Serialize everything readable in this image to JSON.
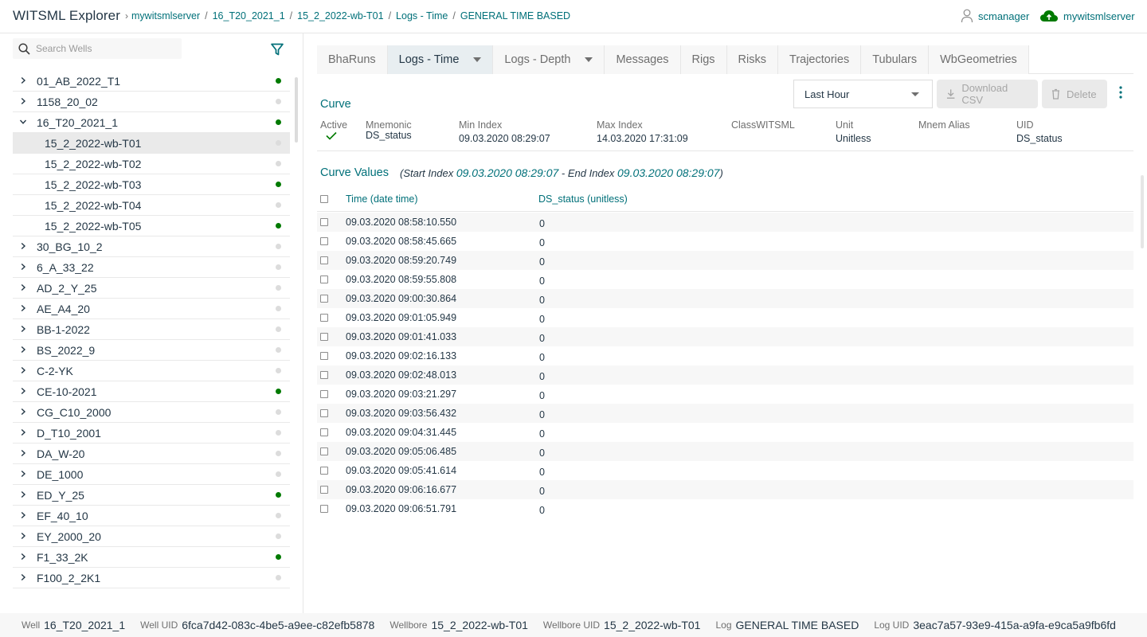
{
  "app_title": "WITSML Explorer",
  "breadcrumb": [
    "mywitsmlserver",
    "16_T20_2021_1",
    "15_2_2022-wb-T01",
    "Logs - Time",
    "GENERAL TIME BASED"
  ],
  "user": "scmanager",
  "server": "mywitsmlserver",
  "search": {
    "placeholder": "Search Wells"
  },
  "tree": [
    {
      "label": "01_AB_2022_T1",
      "expanded": false,
      "child": false,
      "active": true
    },
    {
      "label": "1158_20_02",
      "expanded": false,
      "child": false,
      "active": false
    },
    {
      "label": "16_T20_2021_1",
      "expanded": true,
      "child": false,
      "active": true
    },
    {
      "label": "15_2_2022-wb-T01",
      "child": true,
      "active": false,
      "selected": true
    },
    {
      "label": "15_2_2022-wb-T02",
      "child": true,
      "active": false
    },
    {
      "label": "15_2_2022-wb-T03",
      "child": true,
      "active": true
    },
    {
      "label": "15_2_2022-wb-T04",
      "child": true,
      "active": false
    },
    {
      "label": "15_2_2022-wb-T05",
      "child": true,
      "active": true
    },
    {
      "label": "30_BG_10_2",
      "expanded": false,
      "child": false,
      "active": false
    },
    {
      "label": "6_A_33_22",
      "expanded": false,
      "child": false,
      "active": false
    },
    {
      "label": "AD_2_Y_25",
      "expanded": false,
      "child": false,
      "active": false
    },
    {
      "label": "AE_A4_20",
      "expanded": false,
      "child": false,
      "active": false
    },
    {
      "label": "BB-1-2022",
      "expanded": false,
      "child": false,
      "active": false
    },
    {
      "label": "BS_2022_9",
      "expanded": false,
      "child": false,
      "active": false
    },
    {
      "label": "C-2-YK",
      "expanded": false,
      "child": false,
      "active": false
    },
    {
      "label": "CE-10-2021",
      "expanded": false,
      "child": false,
      "active": true
    },
    {
      "label": "CG_C10_2000",
      "expanded": false,
      "child": false,
      "active": false
    },
    {
      "label": "D_T10_2001",
      "expanded": false,
      "child": false,
      "active": false
    },
    {
      "label": "DA_W-20",
      "expanded": false,
      "child": false,
      "active": false
    },
    {
      "label": "DE_1000",
      "expanded": false,
      "child": false,
      "active": false
    },
    {
      "label": "ED_Y_25",
      "expanded": false,
      "child": false,
      "active": true
    },
    {
      "label": "EF_40_10",
      "expanded": false,
      "child": false,
      "active": false
    },
    {
      "label": "EY_2000_20",
      "expanded": false,
      "child": false,
      "active": false
    },
    {
      "label": "F1_33_2K",
      "expanded": false,
      "child": false,
      "active": true
    },
    {
      "label": "F100_2_2K1",
      "expanded": false,
      "child": false,
      "active": false
    }
  ],
  "tabs": [
    {
      "label": "BhaRuns",
      "active": false,
      "dropdown": false
    },
    {
      "label": "Logs - Time",
      "active": true,
      "dropdown": true
    },
    {
      "label": "Logs - Depth",
      "active": false,
      "dropdown": true
    },
    {
      "label": "Messages",
      "active": false,
      "dropdown": false
    },
    {
      "label": "Rigs",
      "active": false,
      "dropdown": false
    },
    {
      "label": "Risks",
      "active": false,
      "dropdown": false
    },
    {
      "label": "Trajectories",
      "active": false,
      "dropdown": false
    },
    {
      "label": "Tubulars",
      "active": false,
      "dropdown": false
    },
    {
      "label": "WbGeometries",
      "active": false,
      "dropdown": false
    }
  ],
  "toolbar": {
    "range": "Last Hour",
    "download": "Download CSV",
    "delete": "Delete"
  },
  "curve": {
    "title": "Curve",
    "headers": {
      "active": "Active",
      "mnemonic": "Mnemonic",
      "min_index": "Min Index",
      "max_index": "Max Index",
      "class": "ClassWITSML",
      "unit": "Unit",
      "alias": "Mnem Alias",
      "uid": "UID"
    },
    "values": {
      "mnemonic": "DS_status",
      "min_index": "09.03.2020 08:29:07",
      "max_index": "14.03.2020 17:31:09",
      "class": "",
      "unit": "Unitless",
      "alias": "",
      "uid": "DS_status"
    }
  },
  "curve_values": {
    "title": "Curve Values",
    "start_label": "(Start Index ",
    "start": "09.03.2020 08:29:07",
    "end_label": " - End Index ",
    "end": "09.03.2020 08:29:07",
    "close": ")",
    "col_time": "Time (date time)",
    "col_value": "DS_status (unitless)",
    "rows": [
      {
        "time": "09.03.2020 08:58:10.550",
        "value": "0"
      },
      {
        "time": "09.03.2020 08:58:45.665",
        "value": "0"
      },
      {
        "time": "09.03.2020 08:59:20.749",
        "value": "0"
      },
      {
        "time": "09.03.2020 08:59:55.808",
        "value": "0"
      },
      {
        "time": "09.03.2020 09:00:30.864",
        "value": "0"
      },
      {
        "time": "09.03.2020 09:01:05.949",
        "value": "0"
      },
      {
        "time": "09.03.2020 09:01:41.033",
        "value": "0"
      },
      {
        "time": "09.03.2020 09:02:16.133",
        "value": "0"
      },
      {
        "time": "09.03.2020 09:02:48.013",
        "value": "0"
      },
      {
        "time": "09.03.2020 09:03:21.297",
        "value": "0"
      },
      {
        "time": "09.03.2020 09:03:56.432",
        "value": "0"
      },
      {
        "time": "09.03.2020 09:04:31.445",
        "value": "0"
      },
      {
        "time": "09.03.2020 09:05:06.485",
        "value": "0"
      },
      {
        "time": "09.03.2020 09:05:41.614",
        "value": "0"
      },
      {
        "time": "09.03.2020 09:06:16.677",
        "value": "0"
      },
      {
        "time": "09.03.2020 09:06:51.791",
        "value": "0"
      }
    ]
  },
  "footer": [
    {
      "key": "Well",
      "value": "16_T20_2021_1"
    },
    {
      "key": "Well UID",
      "value": "6fca7d42-083c-4be5-a9ee-c82efb5878"
    },
    {
      "key": "Wellbore",
      "value": "15_2_2022-wb-T01"
    },
    {
      "key": "Wellbore UID",
      "value": "15_2_2022-wb-T01"
    },
    {
      "key": "Log",
      "value": "GENERAL TIME BASED"
    },
    {
      "key": "Log UID",
      "value": "3eac7a57-93e9-415a-a9fa-e9ca5a9fb6fd"
    }
  ],
  "colors": {
    "primary": "#007079",
    "text": "#243746",
    "active_dot": "#007a00",
    "inactive_dot": "#dcdcdc"
  }
}
